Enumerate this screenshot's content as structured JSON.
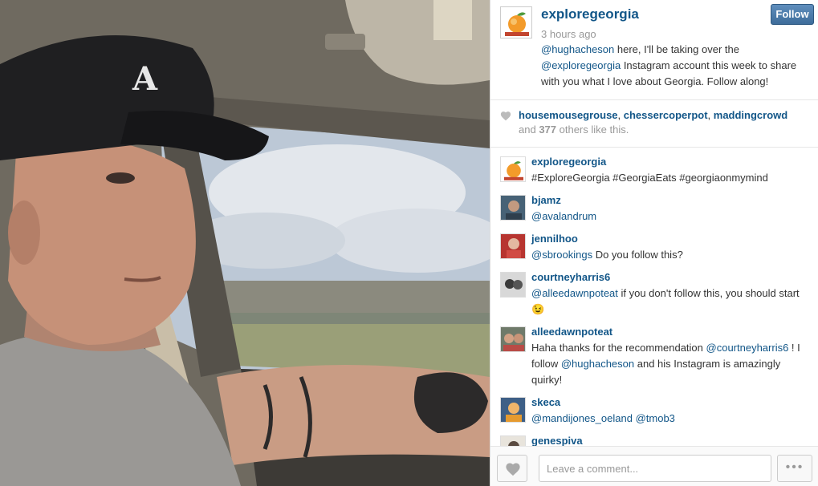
{
  "photo": {
    "alt": "Selfie of a man wearing a baseball cap driving a car"
  },
  "post": {
    "username": "exploregeorgia",
    "timestamp": "3 hours ago",
    "follow_label": "Follow",
    "caption": {
      "mention1": "@hughacheson",
      "text1": " here, I'll be taking over the ",
      "mention2": "@exploregeorgia",
      "text2": " Instagram account this week to share with you what I love about Georgia. Follow along!"
    }
  },
  "likes": {
    "liker1": "housemousegrouse",
    "sep1": ", ",
    "liker2": "chessercoperpot",
    "sep2": ", ",
    "liker3": "maddingcrowd",
    "others_prefix": "and ",
    "others_count": "377",
    "others_suffix": " others like this."
  },
  "comments": [
    {
      "user": "exploregeorgia",
      "parts": [
        {
          "t": "#ExploreGeorgia #GeorgiaEats #georgiaonmymind"
        }
      ]
    },
    {
      "user": "bjamz",
      "parts": [
        {
          "m": "@avalandrum"
        }
      ]
    },
    {
      "user": "jennilhoo",
      "parts": [
        {
          "m": "@sbrookings"
        },
        {
          "t": " Do you follow this?"
        }
      ]
    },
    {
      "user": "courtneyharris6",
      "parts": [
        {
          "m": "@alleedawnpoteat"
        },
        {
          "t": " if you don't follow this, you should start 😉"
        }
      ]
    },
    {
      "user": "alleedawnpoteat",
      "parts": [
        {
          "t": "Haha thanks for the recommendation "
        },
        {
          "m": "@courtneyharris6"
        },
        {
          "t": " ! I follow "
        },
        {
          "m": "@hughacheson"
        },
        {
          "t": " and his Instagram is amazingly quirky!"
        }
      ]
    },
    {
      "user": "skeca",
      "parts": [
        {
          "m": "@mandijones_oeland"
        },
        {
          "t": " "
        },
        {
          "m": "@tmob3"
        }
      ]
    },
    {
      "user": "genespiva",
      "parts": []
    }
  ],
  "footer": {
    "comment_placeholder": "Leave a comment...",
    "more_label": "•••"
  },
  "colors": {
    "link": "#125688",
    "follow_button": "#4a7aab",
    "muted": "#999999"
  },
  "icons": {
    "like": "heart-icon",
    "more": "ellipsis-icon"
  }
}
